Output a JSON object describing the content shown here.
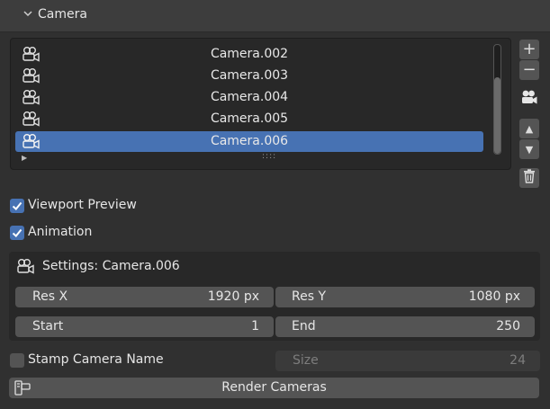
{
  "panel": {
    "title": "Camera"
  },
  "camera_list": {
    "items": [
      {
        "label": "Camera.002",
        "selected": false
      },
      {
        "label": "Camera.003",
        "selected": false
      },
      {
        "label": "Camera.004",
        "selected": false
      },
      {
        "label": "Camera.005",
        "selected": false
      },
      {
        "label": "Camera.006",
        "selected": true
      }
    ],
    "grip": "::::"
  },
  "side_buttons": {
    "add": "+",
    "remove": "−",
    "move_up": "▲",
    "move_down": "▼"
  },
  "options": {
    "viewport_preview": {
      "label": "Viewport Preview",
      "checked": true
    },
    "animation": {
      "label": "Animation",
      "checked": true
    }
  },
  "settings": {
    "title": "Settings: Camera.006",
    "res_x": {
      "label": "Res X",
      "value": "1920 px"
    },
    "res_y": {
      "label": "Res Y",
      "value": "1080 px"
    },
    "start": {
      "label": "Start",
      "value": "1"
    },
    "end": {
      "label": "End",
      "value": "250"
    }
  },
  "stamp": {
    "label": "Stamp Camera Name",
    "checked": false,
    "size_label": "Size",
    "size_value": "24"
  },
  "render": {
    "label": "Render Cameras"
  },
  "colors": {
    "accent": "#4772b3",
    "background": "#303030",
    "field": "#545454"
  }
}
